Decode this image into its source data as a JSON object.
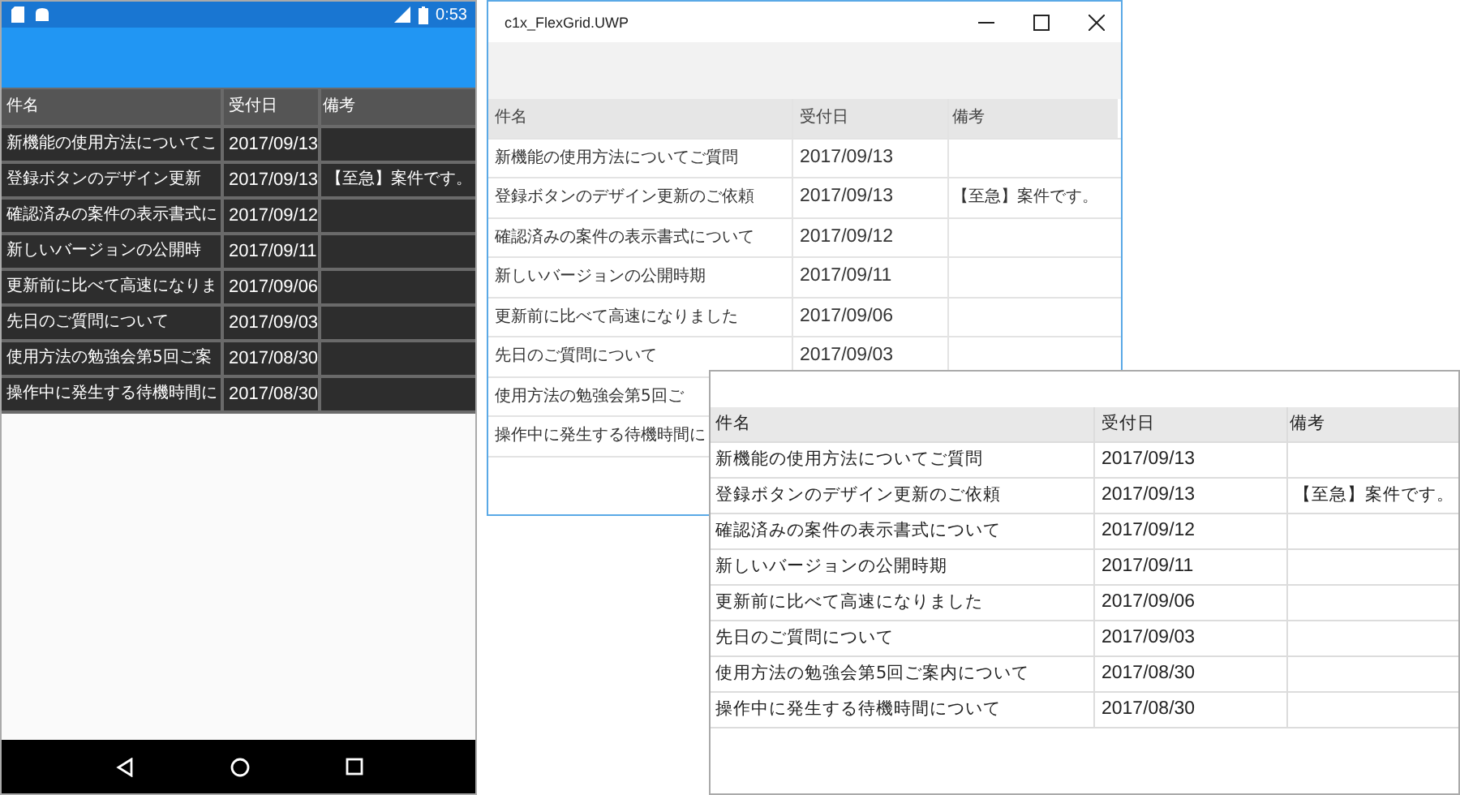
{
  "android": {
    "status_bar": {
      "time": "0:53"
    },
    "grid": {
      "columns": [
        "件名",
        "受付日",
        "備考"
      ],
      "rows": [
        {
          "name": "新機能の使用方法についてこ",
          "date": "2017/09/13"
        },
        {
          "name": "登録ボタンのデザイン更新",
          "date": "2017/09/13",
          "remarks": "【至急】案件です。"
        },
        {
          "name": "確認済みの案件の表示書式に",
          "date": "2017/09/12"
        },
        {
          "name": "新しいバージョンの公開時",
          "date": "2017/09/11"
        },
        {
          "name": "更新前に比べて高速になりま",
          "date": "2017/09/06"
        },
        {
          "name": "先日のご質問について",
          "date": "2017/09/03"
        },
        {
          "name": "使用方法の勉強会第5回ご案",
          "date": "2017/08/30"
        },
        {
          "name": "操作中に発生する待機時間に",
          "date": "2017/08/30"
        }
      ]
    }
  },
  "uwp_window": {
    "title": "c1x_FlexGrid.UWP",
    "grid": {
      "columns": [
        "件名",
        "受付日",
        "備考"
      ],
      "rows": [
        {
          "name": "新機能の使用方法についてご質問",
          "date": "2017/09/13"
        },
        {
          "name": "登録ボタンのデザイン更新のご依頼",
          "date": "2017/09/13",
          "remarks": "【至急】案件です。"
        },
        {
          "name": "確認済みの案件の表示書式について",
          "date": "2017/09/12"
        },
        {
          "name": "新しいバージョンの公開時期",
          "date": "2017/09/11"
        },
        {
          "name": "更新前に比べて高速になりました",
          "date": "2017/09/06"
        },
        {
          "name": "先日のご質問について",
          "date": "2017/09/03"
        },
        {
          "name": "使用方法の勉強会第5回ご"
        },
        {
          "name": "操作中に発生する待機時間に"
        }
      ]
    }
  },
  "mac_window": {
    "grid": {
      "columns": [
        "件名",
        "受付日",
        "備考"
      ],
      "rows": [
        {
          "name": "新機能の使用方法についてご質問",
          "date": "2017/09/13"
        },
        {
          "name": "登録ボタンのデザイン更新のご依頼",
          "date": "2017/09/13",
          "remarks": "【至急】案件です。"
        },
        {
          "name": "確認済みの案件の表示書式について",
          "date": "2017/09/12"
        },
        {
          "name": "新しいバージョンの公開時期",
          "date": "2017/09/11"
        },
        {
          "name": "更新前に比べて高速になりました",
          "date": "2017/09/06"
        },
        {
          "name": "先日のご質問について",
          "date": "2017/09/03"
        },
        {
          "name": "使用方法の勉強会第5回ご案内について",
          "date": "2017/08/30"
        },
        {
          "name": "操作中に発生する待機時間について",
          "date": "2017/08/30"
        }
      ]
    }
  }
}
